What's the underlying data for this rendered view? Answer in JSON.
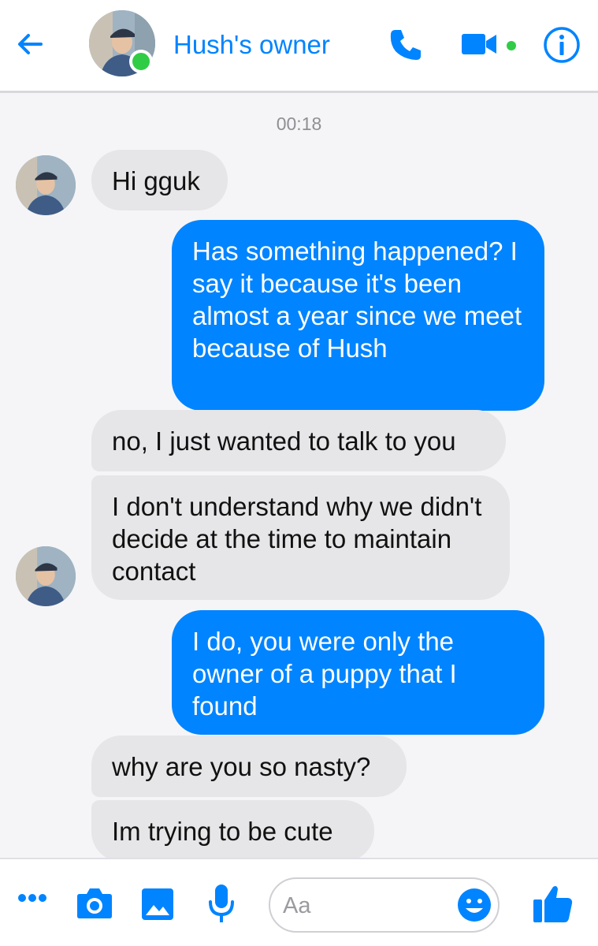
{
  "header": {
    "title": "Hush's owner",
    "back_icon": "arrow-left-icon",
    "phone_icon": "phone-icon",
    "video_icon": "video-camera-icon",
    "info_icon": "info-icon",
    "accent": "#0084ff",
    "online_color": "#31cc46"
  },
  "conversation": {
    "timestamp": "00:18",
    "messages": [
      {
        "from": "them",
        "text": "Hi gguk"
      },
      {
        "from": "me",
        "text": "Has something happened? I say it because it's been almost a year since we meet because of Hush"
      },
      {
        "from": "them",
        "text": "no, I just wanted to talk to you"
      },
      {
        "from": "them",
        "text": "I don't understand why we didn't decide at the time to maintain contact"
      },
      {
        "from": "me",
        "text": "I do, you were only the owner of a puppy that I found"
      },
      {
        "from": "them",
        "text": "why are you so nasty?"
      },
      {
        "from": "them",
        "text": "Im trying to be cute"
      }
    ]
  },
  "composer": {
    "placeholder": "Aa",
    "more_icon": "more-dots-icon",
    "camera_icon": "camera-icon",
    "gallery_icon": "image-icon",
    "mic_icon": "microphone-icon",
    "emoji_icon": "emoji-icon",
    "like_icon": "thumbs-up-icon"
  }
}
